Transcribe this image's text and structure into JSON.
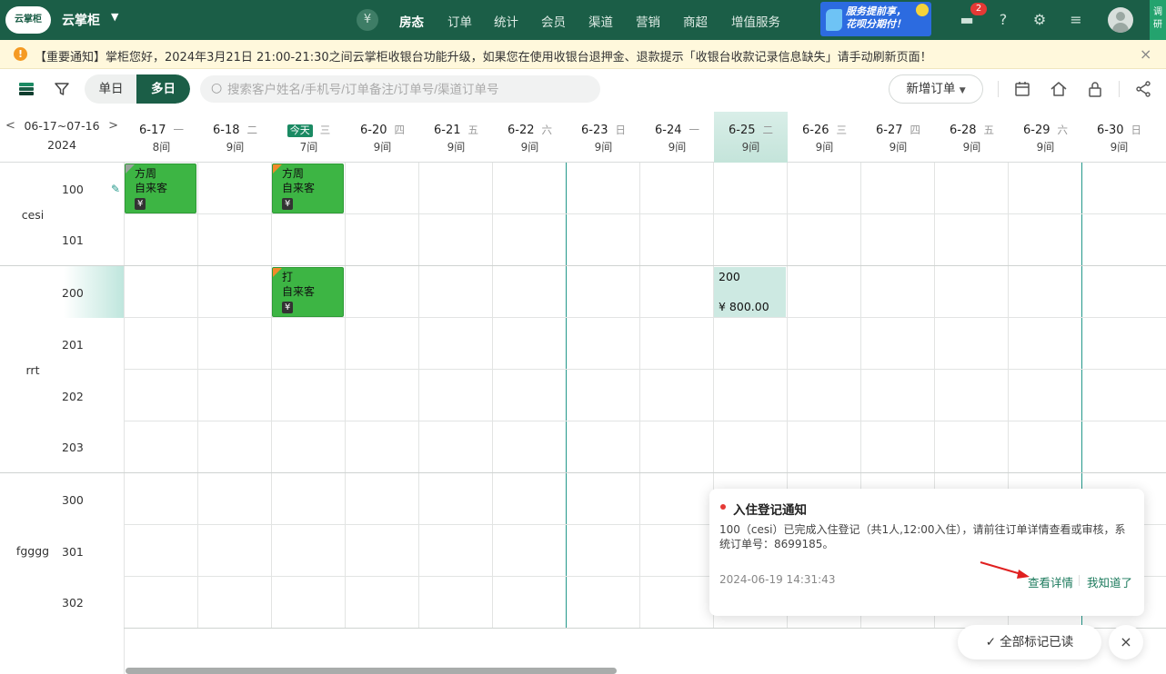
{
  "topbar": {
    "logo_text": "云掌柜",
    "brand": "云掌柜",
    "nav": [
      "房态",
      "订单",
      "统计",
      "会员",
      "渠道",
      "营销",
      "商超",
      "增值服务"
    ],
    "active_nav": "房态",
    "promo_line1": "服务提前享，",
    "promo_line2": "花呗分期付！",
    "message_badge": "2",
    "side_tab": "调研",
    "accent": "#1b5e47"
  },
  "notice": {
    "text": "【重要通知】掌柜您好，2024年3月21日 21:00-21:30之间云掌柜收银台功能升级，如果您在使用收银台退押金、退款提示「收银台收款记录信息缺失」请手动刷新页面！"
  },
  "toolbar": {
    "single_day": "单日",
    "multi_day": "多日",
    "search_placeholder": "搜索客户姓名/手机号/订单备注/订单号/渠道订单号",
    "new_order": "新增订单"
  },
  "calendar": {
    "range": "06-17~07-16",
    "year": "2024",
    "today_label": "今天",
    "days": [
      {
        "date": "6-17",
        "weekday": "一",
        "count": "8间"
      },
      {
        "date": "6-18",
        "weekday": "二",
        "count": "9间"
      },
      {
        "date": "6-19",
        "weekday": "三",
        "count": "7间",
        "today": true
      },
      {
        "date": "6-20",
        "weekday": "四",
        "count": "9间"
      },
      {
        "date": "6-21",
        "weekday": "五",
        "count": "9间"
      },
      {
        "date": "6-22",
        "weekday": "六",
        "count": "9间"
      },
      {
        "date": "6-23",
        "weekday": "日",
        "count": "9间"
      },
      {
        "date": "6-24",
        "weekday": "一",
        "count": "9间"
      },
      {
        "date": "6-25",
        "weekday": "二",
        "count": "9间",
        "selected": true
      },
      {
        "date": "6-26",
        "weekday": "三",
        "count": "9间"
      },
      {
        "date": "6-27",
        "weekday": "四",
        "count": "9间"
      },
      {
        "date": "6-28",
        "weekday": "五",
        "count": "9间"
      },
      {
        "date": "6-29",
        "weekday": "六",
        "count": "9间"
      },
      {
        "date": "6-30",
        "weekday": "日",
        "count": "9间"
      }
    ],
    "groups": [
      {
        "name": "cesi",
        "rooms": [
          "100",
          "101"
        ]
      },
      {
        "name": "rrt",
        "rooms": [
          "200",
          "201",
          "202",
          "203"
        ]
      },
      {
        "name": "fgggg",
        "rooms": [
          "300",
          "301",
          "302"
        ]
      }
    ],
    "bookings": [
      {
        "room": "100",
        "day": "6-17",
        "guest": "方周",
        "source": "自来客",
        "tag": "¥",
        "corner": "gray"
      },
      {
        "room": "100",
        "day": "6-19",
        "guest": "方周",
        "source": "自来客",
        "tag": "¥",
        "corner": "orange"
      },
      {
        "room": "200",
        "day": "6-19",
        "guest": "打",
        "source": "自来客",
        "tag": "¥",
        "corner": "orange"
      }
    ],
    "price_cell": {
      "room": "200",
      "day": "6-25",
      "title": "200",
      "price": "¥ 800.00"
    }
  },
  "popup": {
    "title": "入住登记通知",
    "body": "100（cesi）已完成入住登记（共1人,12:00入住），请前往订单详情查看或审核，系统订单号：8699185。",
    "time": "2024-06-19 14:31:43",
    "view": "查看详情",
    "ok": "我知道了"
  },
  "footer": {
    "mark_all": "全部标记已读"
  }
}
